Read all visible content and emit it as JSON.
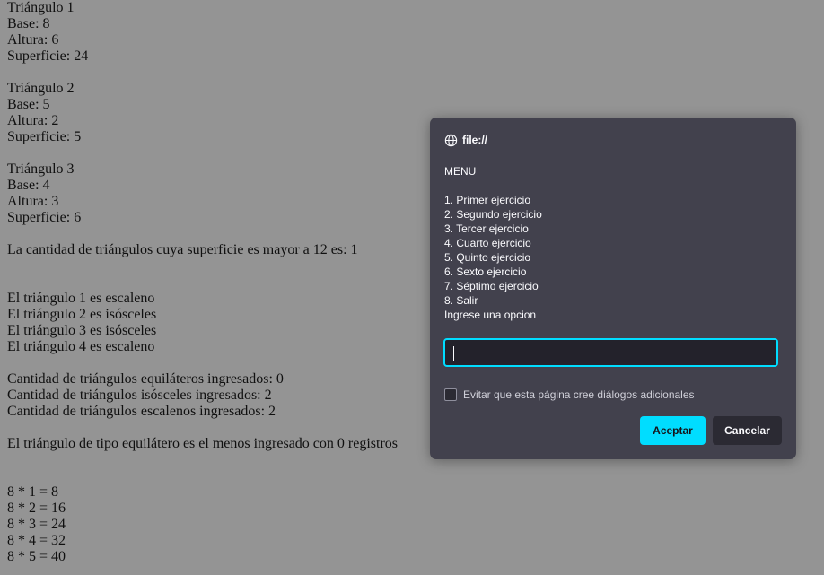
{
  "page": {
    "lines": [
      "Triángulo 1",
      "Base: 8",
      "Altura: 6",
      "Superficie: 24",
      "",
      "Triángulo 2",
      "Base: 5",
      "Altura: 2",
      "Superficie: 5",
      "",
      "Triángulo 3",
      "Base: 4",
      "Altura: 3",
      "Superficie: 6",
      "",
      "La cantidad de triángulos cuya superficie es mayor a 12 es: 1",
      "",
      "",
      "El triángulo 1 es escaleno",
      "El triángulo 2 es isósceles",
      "El triángulo 3 es isósceles",
      "El triángulo 4 es escaleno",
      "",
      "Cantidad de triángulos equiláteros ingresados: 0",
      "Cantidad de triángulos isósceles ingresados: 2",
      "Cantidad de triángulos escalenos ingresados: 2",
      "",
      "El triángulo de tipo equilátero es el menos ingresado con 0 registros",
      "",
      "",
      "8 * 1 = 8",
      "8 * 2 = 16",
      "8 * 3 = 24",
      "8 * 4 = 32",
      "8 * 5 = 40"
    ]
  },
  "dialog": {
    "origin": "file://",
    "origin_icon": "globe-icon",
    "message_lines": [
      "MENU",
      "",
      "1. Primer ejercicio",
      "2. Segundo ejercicio",
      "3. Tercer ejercicio",
      "4. Cuarto ejercicio",
      "5. Quinto ejercicio",
      "6. Sexto ejercicio",
      "7. Séptimo ejercicio",
      "8. Salir",
      "Ingrese una opcion"
    ],
    "input_value": "",
    "checkbox_label": "Evitar que esta página cree diálogos adicionales",
    "checkbox_checked": false,
    "accept_label": "Aceptar",
    "cancel_label": "Cancelar",
    "accent_color": "#00ddff"
  }
}
